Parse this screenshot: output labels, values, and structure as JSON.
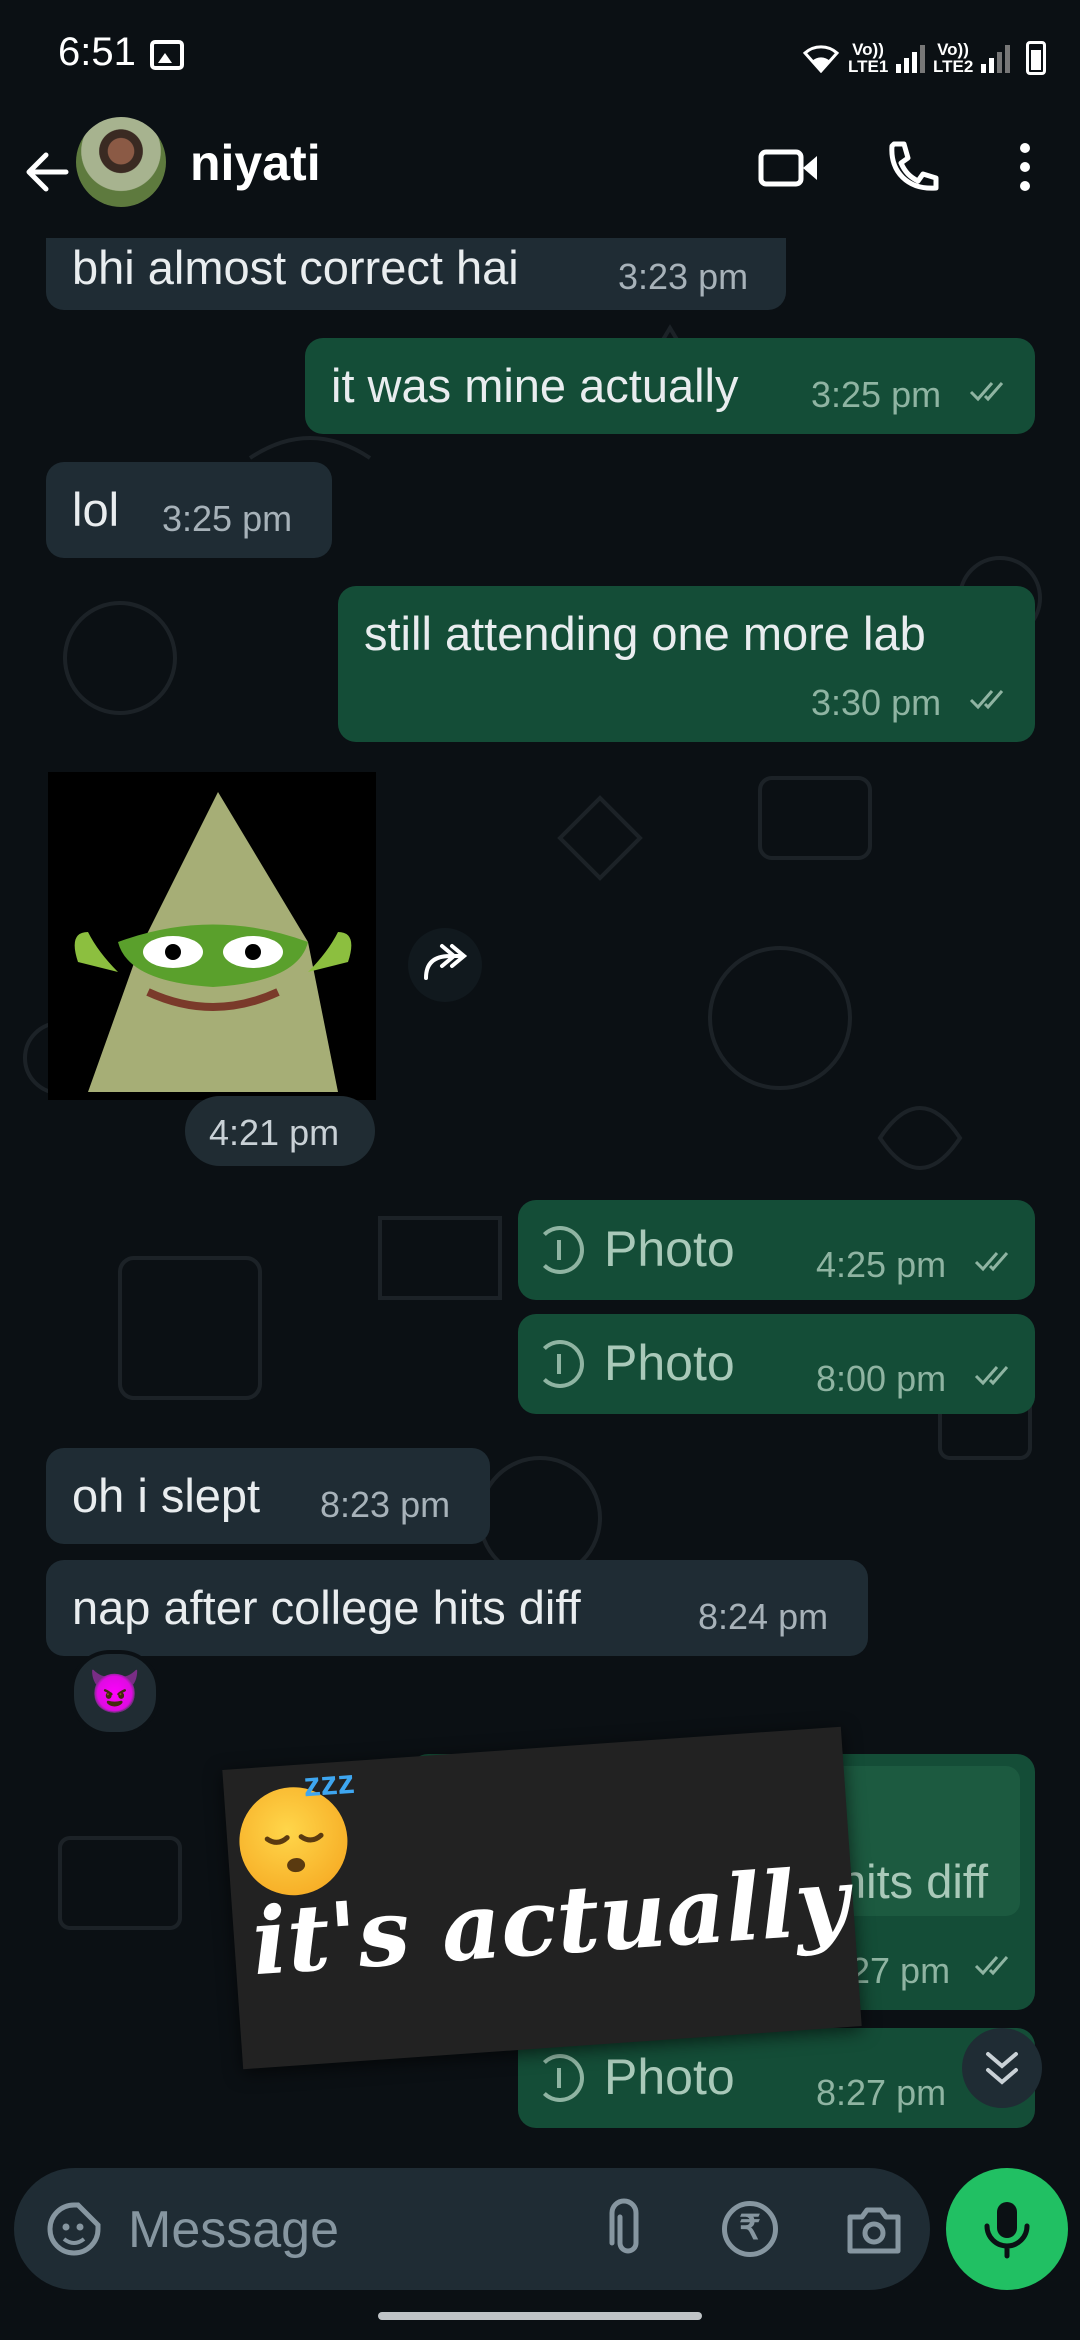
{
  "status_bar": {
    "time": "6:51",
    "sim1": "Vo)) LTE1",
    "sim2": "Vo)) LTE2"
  },
  "header": {
    "contact_name": "niyati",
    "icons": [
      "back-arrow-icon",
      "avatar",
      "video-call-icon",
      "voice-call-icon",
      "more-vert-icon"
    ]
  },
  "messages": [
    {
      "dir": "in",
      "text": "bhi almost correct hai",
      "time": "3:23 pm"
    },
    {
      "dir": "out",
      "text": "it was mine actually",
      "time": "3:25 pm",
      "status": "read"
    },
    {
      "dir": "in",
      "text": "lol",
      "time": "3:25 pm"
    },
    {
      "dir": "out",
      "text": "still attending one more lab",
      "time": "3:30 pm",
      "status": "read"
    },
    {
      "dir": "in",
      "type": "sticker",
      "time": "4:21 pm"
    },
    {
      "dir": "out",
      "type": "photo",
      "text": "Photo",
      "time": "4:25 pm",
      "status": "read"
    },
    {
      "dir": "out",
      "type": "photo",
      "text": "Photo",
      "time": "8:00 pm",
      "status": "read"
    },
    {
      "dir": "in",
      "text": "oh i slept",
      "time": "8:23 pm"
    },
    {
      "dir": "in",
      "text": "nap after college hits diff",
      "time": "8:24 pm",
      "reaction": "😈"
    },
    {
      "dir": "out",
      "text": "hits diff",
      "time": "27 pm",
      "status": "read",
      "partially_covered": true
    },
    {
      "dir": "out",
      "type": "photo",
      "text": "Photo",
      "time": "8:27 pm",
      "status": "read"
    }
  ],
  "overlay_sticker": {
    "emoji": "😴",
    "zzz": "zzz",
    "caption": "it's actually"
  },
  "input": {
    "placeholder": "Message",
    "rupee": "₹"
  },
  "colors": {
    "background": "#0b1014",
    "incoming_bubble": "#1f2c34",
    "outgoing_bubble": "#144d37",
    "accent": "#21c063"
  }
}
